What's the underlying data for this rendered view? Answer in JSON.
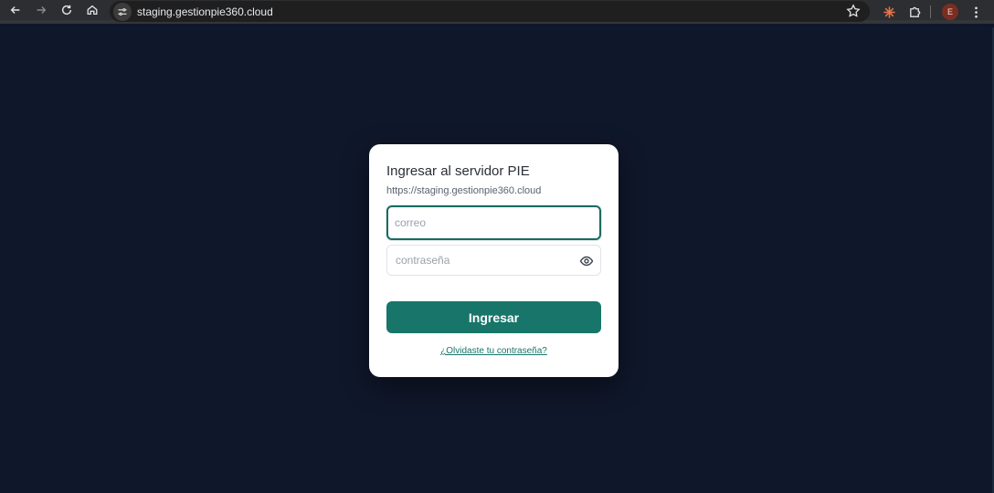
{
  "browser": {
    "url": "staging.gestionpie360.cloud",
    "profile_initial": "E",
    "icons": {
      "back": "arrow-left-icon",
      "forward": "arrow-right-icon",
      "reload": "reload-icon",
      "home": "home-icon",
      "site_info": "tune-icon",
      "bookmark": "star-icon",
      "extension_1": "asterisk-icon",
      "extensions": "puzzle-icon",
      "menu": "kebab-icon"
    }
  },
  "login": {
    "title": "Ingresar al servidor PIE",
    "server_url": "https://staging.gestionpie360.cloud",
    "email_placeholder": "correo",
    "email_value": "",
    "password_placeholder": "contraseña",
    "password_value": "",
    "submit_label": "Ingresar",
    "forgot_label": "¿Olvidaste tu contraseña?"
  },
  "colors": {
    "page_background": "#0f172a",
    "accent": "#17756a",
    "card_background": "#ffffff"
  }
}
